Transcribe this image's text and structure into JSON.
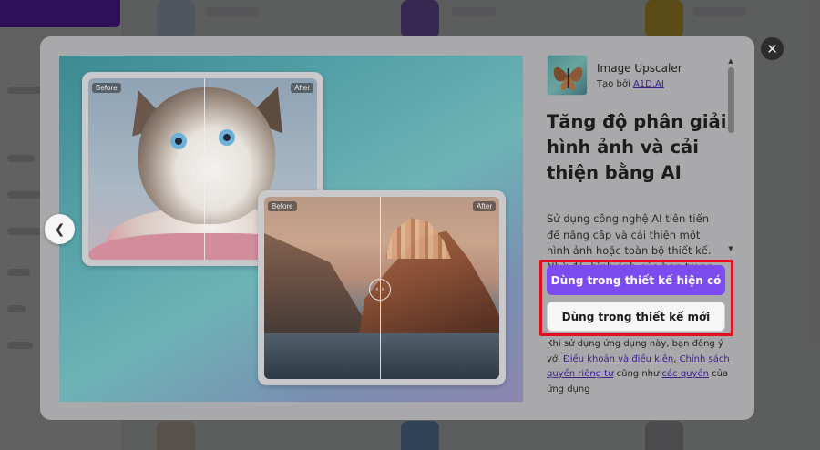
{
  "preview": {
    "cat": {
      "before_label": "Before",
      "after_label": "After"
    },
    "coast": {
      "before_label": "Before",
      "after_label": "After"
    }
  },
  "app": {
    "name": "Image Upscaler",
    "author_prefix": "Tạo bởi",
    "author_name": "A1D.AI"
  },
  "headline": "Tăng độ phân giải hình ảnh và cải thiện bằng AI",
  "description": "Sử dụng công nghệ AI tiên tiến để nâng cấp và cải thiện một hình ảnh hoặc toàn bộ thiết kế. Nhờ đó, hình ảnh của bạn trong",
  "buttons": {
    "use_in_current": "Dùng trong thiết kế hiện có",
    "use_in_new": "Dùng trong thiết kế mới"
  },
  "terms": {
    "prefix": "Khi sử dụng ứng dụng này, bạn đồng ý với",
    "terms_link": "Điều khoản và điều kiện",
    "sep": ",",
    "privacy_link": "Chính sách quyền riêng tư",
    "middle": "cũng như",
    "rights_link": "các quyền",
    "suffix": "của ứng dụng"
  },
  "colors": {
    "primary_button": "#7d4cf0",
    "highlight_box": "#e0101f",
    "brand": "#7d2ae8"
  },
  "icons": {
    "close": "close-icon",
    "prev": "chevron-left-icon",
    "slider_handle": "compare-handle-icon",
    "scroll_up": "scroll-up-icon",
    "scroll_down": "scroll-down-icon"
  }
}
